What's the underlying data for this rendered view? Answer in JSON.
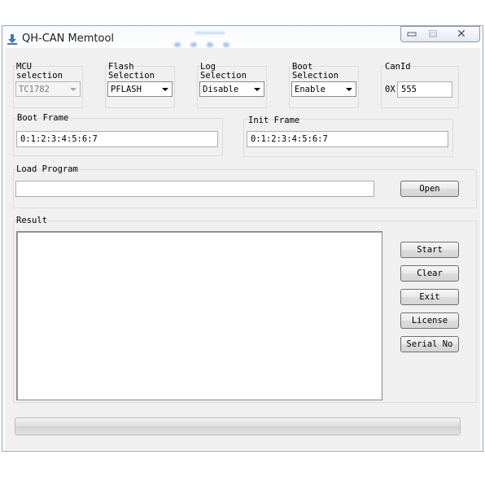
{
  "window": {
    "title": "QH-CAN Memtool",
    "icons": {
      "app": "download-arrow-icon",
      "minimize": "minimize-icon",
      "maximize": "maximize-icon",
      "close": "close-icon"
    },
    "close_glyph": "✕"
  },
  "mcu": {
    "label_line1": "MCU",
    "label_line2": "selection",
    "value": "TC1782",
    "disabled": true
  },
  "flash": {
    "label_line1": "Flash",
    "label_line2": "Selection",
    "value": "PFLASH"
  },
  "log": {
    "label_line1": "Log",
    "label_line2": "Selection",
    "value": "Disable"
  },
  "boot": {
    "label_line1": "Boot",
    "label_line2": "Selection",
    "value": "Enable"
  },
  "canid": {
    "label": "CanId",
    "prefix": "0X",
    "value": "555"
  },
  "boot_frame": {
    "label": "Boot Frame",
    "value": "0:1:2:3:4:5:6:7"
  },
  "init_frame": {
    "label": "Init Frame",
    "value": "0:1:2:3:4:5:6:7"
  },
  "load_program": {
    "label": "Load Program",
    "path": "",
    "open_label": "Open"
  },
  "result": {
    "label": "Result",
    "text": "",
    "buttons": {
      "start": "Start",
      "clear": "Clear",
      "exit": "Exit",
      "license": "License",
      "serial": "Serial No"
    }
  },
  "progress": {
    "value": 0
  },
  "colors": {
    "frame_border": "#9aa7b5",
    "client_bg": "#f0f0f0",
    "title_glow": "#aac6ee"
  }
}
